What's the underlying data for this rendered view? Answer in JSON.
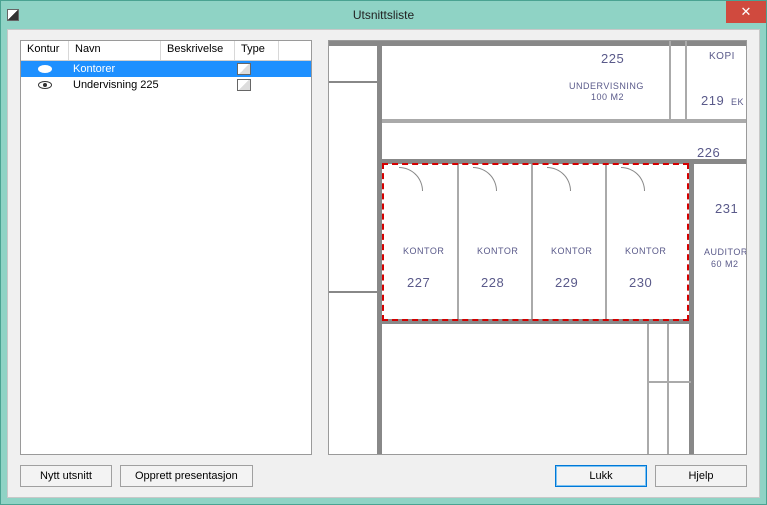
{
  "window": {
    "title": "Utsnittsliste",
    "close": "✕"
  },
  "list": {
    "headers": {
      "kontur": "Kontur",
      "navn": "Navn",
      "beskrivelse": "Beskrivelse",
      "type": "Type"
    },
    "rows": [
      {
        "navn": "Kontorer",
        "selected": true
      },
      {
        "navn": "Undervisning 225",
        "selected": false
      }
    ]
  },
  "buttons": {
    "nytt": "Nytt utsnitt",
    "opprett": "Opprett presentasjon",
    "lukk": "Lukk",
    "hjelp": "Hjelp"
  },
  "plan": {
    "rooms": {
      "r225": "225",
      "undervisning": "UNDERVISNING",
      "undervisning_sub": "100 M2",
      "kopi": "KOPI",
      "r219": "219",
      "ek": "EK",
      "r226": "226",
      "r231": "231",
      "auditor": "AUDITOR",
      "auditor_sub": "60 M2",
      "kontor": "KONTOR",
      "k227": "227",
      "k228": "228",
      "k229": "229",
      "k230": "230"
    }
  }
}
